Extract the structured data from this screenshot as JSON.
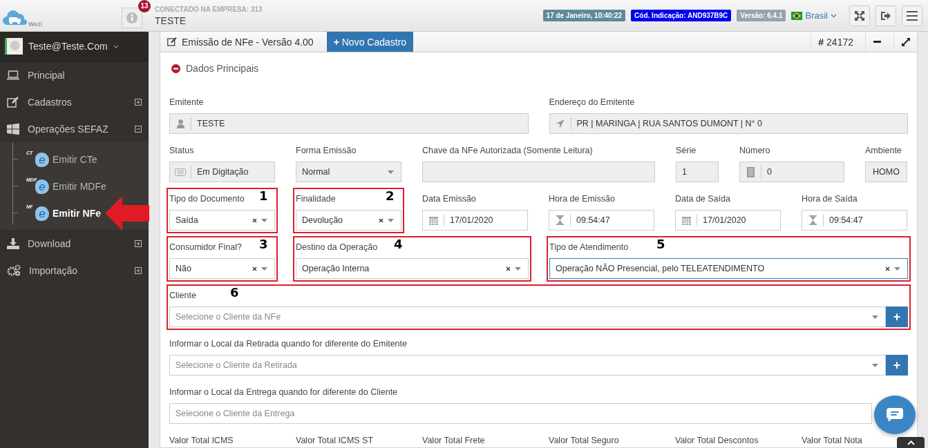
{
  "header": {
    "logo_text": "Wezi",
    "notifications": "13",
    "company_caption": "CONECTADO NA EMPRESA: 313",
    "company_name": "TESTE",
    "badges": [
      {
        "text": "17 de Janeiro, 10:40:22",
        "color": "#5b8a9c"
      },
      {
        "text": "Cód. Indicação: AND937B9C",
        "color": "#0000ee"
      },
      {
        "text": "Versão: 6.4.1",
        "color": "#98a3ab"
      }
    ],
    "language": "Brasil"
  },
  "sidebar": {
    "user": "Teste@Teste.Com",
    "items": [
      {
        "label": "Principal"
      },
      {
        "label": "Cadastros",
        "expanded": false
      },
      {
        "label": "Operações SEFAZ",
        "expanded": true,
        "children": [
          {
            "label": "Emitir CTe",
            "logo_caption": "CT",
            "logo_mark": "e",
            "selected": false
          },
          {
            "label": "Emitir MDFe",
            "logo_caption": "MDF",
            "logo_mark": "e",
            "selected": false
          },
          {
            "label": "Emitir NFe",
            "logo_caption": "NF",
            "logo_mark": "e",
            "selected": true
          }
        ]
      },
      {
        "label": "Download",
        "expanded": false
      },
      {
        "label": "Importação",
        "expanded": false
      }
    ]
  },
  "panel": {
    "title": "Emissão de NFe - Versão 4.00",
    "new_button": "Novo Cadastro",
    "new_button_mark": "+",
    "hash": "#",
    "record_number": "24172",
    "section": "Dados Principais",
    "fields": [
      {
        "label": "Emitente",
        "kind": "user",
        "value": "TESTE",
        "readonly": true
      },
      {
        "label": "Endereço do Emitente",
        "kind": "location",
        "value": "PR | MARINGA | RUA SANTOS DUMONT | N° 0",
        "readonly": true
      },
      {
        "label": "Status",
        "kind": "keyboard",
        "value": "Em Digitação",
        "readonly": true
      },
      {
        "label": "Forma Emissão",
        "kind": "select",
        "value": "Normal",
        "readonly": true
      },
      {
        "label": "Chave da NFe Autorizada (Somente Leitura)",
        "kind": "text",
        "readonly": true
      },
      {
        "label": "Série",
        "kind": "text",
        "value": "1",
        "readonly": true
      },
      {
        "label": "Número",
        "kind": "building",
        "value": "0",
        "readonly": true
      },
      {
        "label": "Ambiente",
        "kind": "text",
        "value": "HOMO",
        "readonly": true,
        "centered": true
      },
      {
        "label": "Tipo do Documento",
        "kind": "select",
        "value": "Saída",
        "readonly": false,
        "clearable": true,
        "annotation": "1"
      },
      {
        "label": "Finalidade",
        "kind": "select",
        "value": "Devolução",
        "readonly": false,
        "clearable": true,
        "annotation": "2"
      },
      {
        "label": "Data Emissão",
        "kind": "date",
        "value": "17/01/2020",
        "readonly": false
      },
      {
        "label": "Hora de Emissão",
        "kind": "time",
        "value": "09:54:47",
        "readonly": false
      },
      {
        "label": "Data de Saída",
        "kind": "date",
        "value": "17/01/2020",
        "readonly": false
      },
      {
        "label": "Hora de Saída",
        "kind": "time",
        "value": "09:54:47",
        "readonly": false
      },
      {
        "label": "Consumidor Final?",
        "kind": "select",
        "value": "Não",
        "readonly": false,
        "clearable": true,
        "annotation": "3"
      },
      {
        "label": "Destino da Operação",
        "kind": "select",
        "value": "Operação Interna",
        "readonly": false,
        "clearable": true,
        "annotation": "4"
      },
      {
        "label": "Tipo de Atendimento",
        "kind": "select",
        "value": "Operação NÃO Presencial, pelo TELEATENDIMENTO",
        "readonly": false,
        "clearable": true,
        "annotation": "5",
        "focused": true
      },
      {
        "label": "Cliente",
        "kind": "select",
        "placeholder": "Selecione o Cliente da NFe",
        "readonly": false,
        "add_button": "+",
        "annotation": "6"
      },
      {
        "label": "Informar o Local da Retirada quando for diferente do Emitente",
        "kind": "select",
        "placeholder": "Selecione o Cliente da Retirada",
        "readonly": false,
        "add_button": "+"
      },
      {
        "label": "Informar o Local da Entrega quando for diferente do Cliente",
        "kind": "text",
        "placeholder": "Selecione o Cliente da Entrega",
        "readonly": false
      },
      {
        "label": "Valor Total ICMS"
      },
      {
        "label": "Valor Total ICMS ST"
      },
      {
        "label": "Valor Total Frete"
      },
      {
        "label": "Valor Total Seguro"
      },
      {
        "label": "Valor Total Descontos"
      },
      {
        "label": "Valor Total Nota"
      }
    ]
  }
}
